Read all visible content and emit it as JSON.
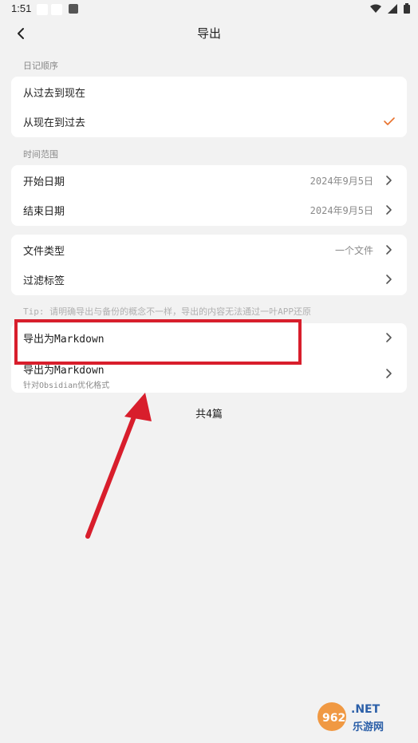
{
  "status": {
    "time": "1:51"
  },
  "header": {
    "title": "导出"
  },
  "sections": {
    "order_label": "日记顺序",
    "range_label": "时间范围"
  },
  "order_options": [
    {
      "label": "从过去到现在",
      "selected": false
    },
    {
      "label": "从现在到过去",
      "selected": true
    }
  ],
  "range": {
    "start_label": "开始日期",
    "start_value": "2024年9月5日",
    "end_label": "结束日期",
    "end_value": "2024年9月5日"
  },
  "options": {
    "file_type_label": "文件类型",
    "file_type_value": "一个文件",
    "filter_label": "过滤标签"
  },
  "tip": "Tip: 请明确导出与备份的概念不一样，导出的内容无法通过一叶APP还原",
  "export": {
    "markdown_label": "导出为Markdown",
    "obsidian_label": "导出为Markdown",
    "obsidian_sub": "针对Obsidian优化格式"
  },
  "count": "共4篇",
  "watermark": {
    "logo": "962.NET",
    "site": "乐游网"
  },
  "colors": {
    "accent": "#e8712c",
    "annotation": "#d81e2c"
  }
}
